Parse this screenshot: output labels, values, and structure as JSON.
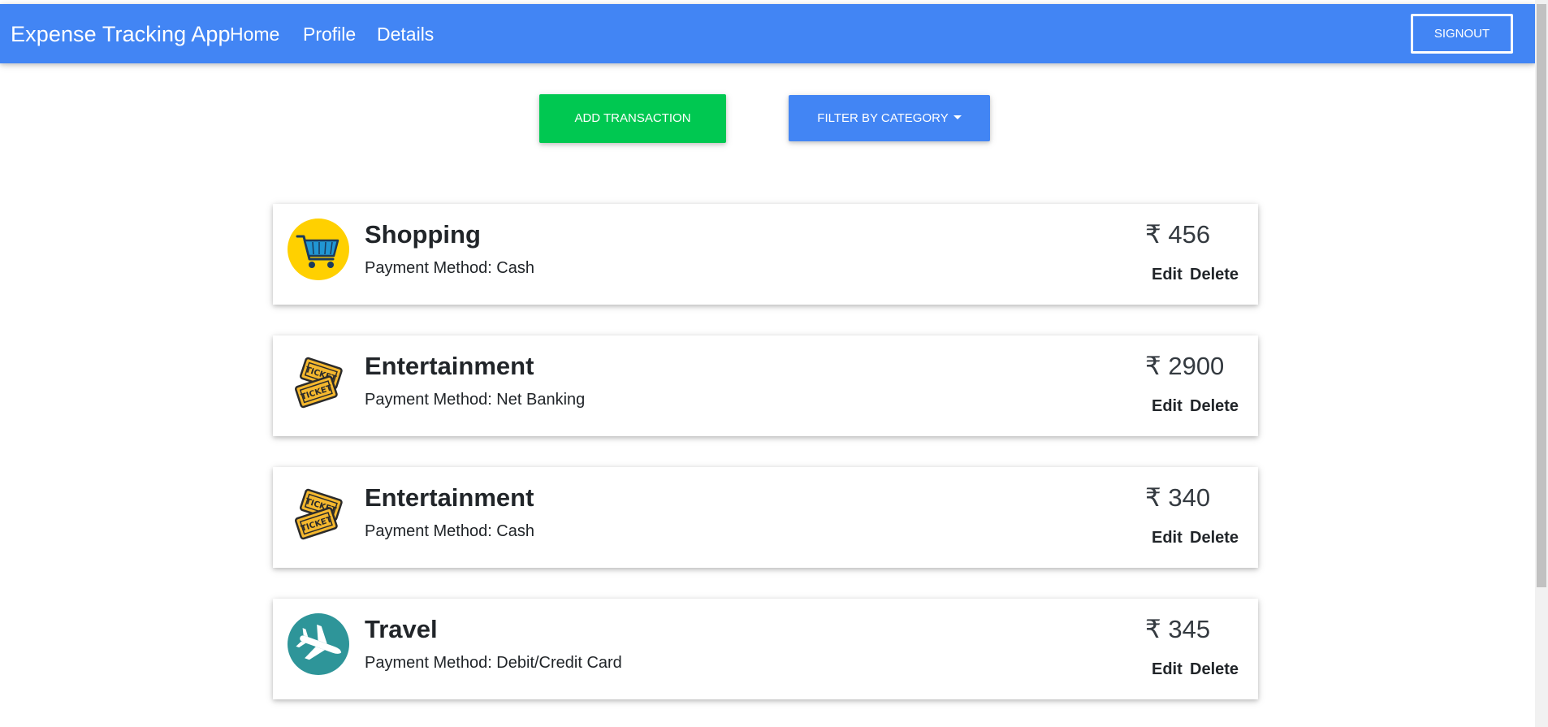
{
  "nav": {
    "brand": "Expense Tracking App",
    "links": [
      "Home",
      "Profile",
      "Details"
    ],
    "signout": "SIGNOUT",
    "color": "#4285f4"
  },
  "actions": {
    "add": "ADD TRANSACTION",
    "filter": "FILTER BY CATEGORY",
    "add_color": "#00c851",
    "filter_color": "#4285f4"
  },
  "transactions": [
    {
      "category": "Shopping",
      "method": "Payment Method: Cash",
      "amount": "₹ 456",
      "icon": "shopping-cart-icon",
      "edit": "Edit",
      "delete": "Delete"
    },
    {
      "category": "Entertainment",
      "method": "Payment Method: Net Banking",
      "amount": "₹ 2900",
      "icon": "tickets-icon",
      "edit": "Edit",
      "delete": "Delete"
    },
    {
      "category": "Entertainment",
      "method": "Payment Method: Cash",
      "amount": "₹ 340",
      "icon": "tickets-icon",
      "edit": "Edit",
      "delete": "Delete"
    },
    {
      "category": "Travel",
      "method": "Payment Method: Debit/Credit Card",
      "amount": "₹ 345",
      "icon": "airplane-icon",
      "edit": "Edit",
      "delete": "Delete"
    }
  ]
}
